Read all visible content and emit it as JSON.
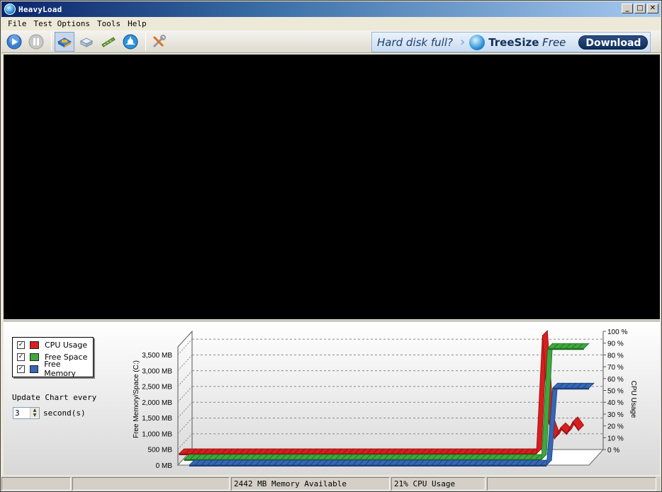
{
  "window": {
    "title": "HeavyLoad"
  },
  "window_buttons": {
    "minimize": "_",
    "maximize": "□",
    "close": "✕"
  },
  "menu": {
    "items": [
      "File",
      "Test Options",
      "Tools",
      "Help"
    ]
  },
  "toolbar": {
    "buttons": [
      "play-icon",
      "pause-icon",
      "cpu-stress-icon",
      "disk-stress-icon",
      "memory-stress-icon",
      "jamsoftware-icon",
      "settings-tools-icon"
    ],
    "ad": {
      "question": "Hard disk full?",
      "arrow": "›",
      "brand_bold": "TreeSize",
      "brand_italic": "Free",
      "button": "Download"
    }
  },
  "legend": {
    "items": [
      {
        "label": "CPU Usage",
        "color": "#d81e1e",
        "checked": true
      },
      {
        "label": "Free Space",
        "color": "#3da83d",
        "checked": true
      },
      {
        "label": "Free Memory",
        "color": "#3567b5",
        "checked": true
      }
    ],
    "check_glyph": "✓"
  },
  "update": {
    "label": "Update Chart every",
    "value": "3",
    "unit": "second(s)",
    "up_glyph": "▲",
    "down_glyph": "▼"
  },
  "chart_data": {
    "type": "line",
    "ylabel": "Free Memory/Space (C:)",
    "y2label": "CPU Usage",
    "y_ticks": [
      "0 MB",
      "500 MB",
      "1,000 MB",
      "1,500 MB",
      "2,000 MB",
      "2,500 MB",
      "3,000 MB",
      "3,500 MB"
    ],
    "ylim": [
      0,
      3750
    ],
    "y2_ticks": [
      "0 %",
      "10 %",
      "20 %",
      "30 %",
      "40 %",
      "50 %",
      "60 %",
      "70 %",
      "80 %",
      "90 %",
      "100 %"
    ],
    "y2lim": [
      0,
      100
    ],
    "grid": true,
    "series": [
      {
        "name": "CPU Usage",
        "axis": "right",
        "color": "#d81e1e",
        "values": [
          0,
          0,
          0,
          0,
          0,
          0,
          0,
          0,
          0,
          0,
          0,
          0,
          0,
          0,
          0,
          0,
          0,
          0,
          0,
          0,
          0,
          0,
          0,
          0,
          0,
          0,
          0,
          0,
          0,
          0,
          0,
          0,
          0,
          0,
          0,
          0,
          0,
          0,
          0,
          0,
          0,
          0,
          0,
          0,
          0,
          0,
          0,
          0,
          0,
          0,
          0,
          0,
          0,
          0,
          0,
          0,
          0,
          0,
          0,
          0,
          100,
          27,
          13,
          22,
          17,
          27,
          20
        ]
      },
      {
        "name": "Free Space",
        "axis": "left",
        "color": "#3da83d",
        "values": [
          0,
          0,
          0,
          0,
          0,
          0,
          0,
          0,
          0,
          0,
          0,
          0,
          0,
          0,
          0,
          0,
          0,
          0,
          0,
          0,
          0,
          0,
          0,
          0,
          0,
          0,
          0,
          0,
          0,
          0,
          0,
          0,
          0,
          0,
          0,
          0,
          0,
          0,
          0,
          0,
          0,
          0,
          0,
          0,
          0,
          0,
          0,
          0,
          0,
          0,
          0,
          0,
          0,
          0,
          0,
          0,
          0,
          0,
          0,
          0,
          3520,
          3520,
          3520,
          3520,
          3520,
          3520,
          3520
        ]
      },
      {
        "name": "Free Memory",
        "axis": "left",
        "color": "#3567b5",
        "values": [
          0,
          0,
          0,
          0,
          0,
          0,
          0,
          0,
          0,
          0,
          0,
          0,
          0,
          0,
          0,
          0,
          0,
          0,
          0,
          0,
          0,
          0,
          0,
          0,
          0,
          0,
          0,
          0,
          0,
          0,
          0,
          0,
          0,
          0,
          0,
          0,
          0,
          0,
          0,
          0,
          0,
          0,
          0,
          0,
          0,
          0,
          0,
          0,
          0,
          0,
          0,
          0,
          0,
          0,
          0,
          0,
          0,
          0,
          0,
          0,
          2442,
          2442,
          2442,
          2442,
          2442,
          2442,
          2442
        ]
      }
    ]
  },
  "status": {
    "panel1": "",
    "panel2": "",
    "memory": "2442 MB Memory Available",
    "cpu": "21% CPU Usage",
    "panel5": ""
  }
}
